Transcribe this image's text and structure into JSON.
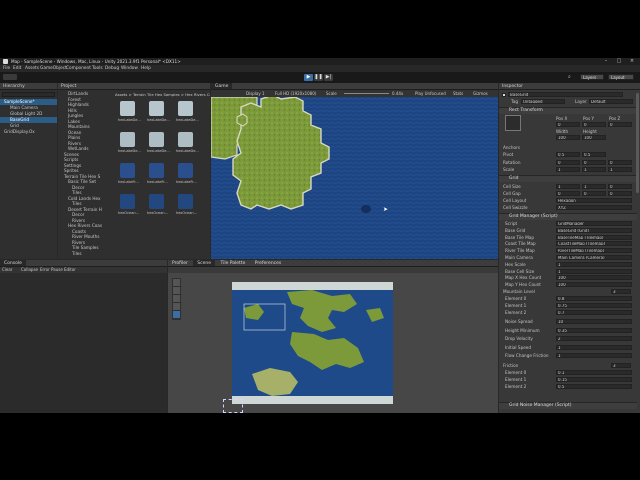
{
  "window": {
    "title": "Map - SampleScene - Windows, Mac, Linux - Unity 2021.3.9f1 Personal* <DX11>",
    "menu": [
      "File",
      "Edit",
      "Assets",
      "GameObject",
      "Component",
      "Tools",
      "Debug",
      "Window",
      "Help"
    ]
  },
  "toolbar": {
    "layers": "Layers",
    "layout": "Layout"
  },
  "hierarchy": {
    "tab": "Hierarchy",
    "items": [
      "SampleScene*",
      "Main Camera",
      "Global Light 2D",
      "BaseGrid",
      "Grid",
      "GridDisplay.Ox"
    ]
  },
  "project": {
    "tab": "Project",
    "tree": [
      "DirtLands",
      "Forest",
      "Highlands",
      "Hills",
      "Jungles",
      "Lakes",
      "Mountains",
      "Ocean",
      "Plains",
      "Rivers",
      "WetLands",
      "Scenes",
      "Scripts",
      "Settings",
      "Sprites",
      "Terrain Tile Hex S",
      "Basic Tile Set",
      "Decor",
      "Tiles",
      "Cold Lands Hex",
      "Tiles",
      "Desert Terrain H",
      "Decor",
      "Rivers",
      "Hex Rivers Coas",
      "Coasts",
      "River Mouths",
      "Rivers",
      "Tile Samples",
      "Tiles"
    ],
    "breadcrumb": "Assets > Terrain Tile Hex Samples > Hex Rivers Coasts > Tiles",
    "assets": [
      "hexLakeDe...",
      "hexLakeDe...",
      "hexLakeDe...",
      "hexLakeDe...",
      "hexLakeDe...",
      "hexLakeDe...",
      "hexLakeFr...",
      "hexLakeFr...",
      "hexLakeFr...",
      "hexOcean...",
      "hexOcean...",
      "hexOcean..."
    ]
  },
  "game": {
    "tab": "Game",
    "display": "Display 1",
    "resolution": "Full HD (1920x1080)",
    "scale_label": "Scale",
    "scale_value": "0.44x",
    "play_mode": "Play Unfocused",
    "stats": "Stats",
    "gizmos": "Gizmos"
  },
  "console": {
    "tab": "Console",
    "buttons": [
      "Clear",
      "Collapse",
      "Error Pause",
      "Editor"
    ]
  },
  "scene": {
    "tabs": [
      "Profiler",
      "Scene",
      "Tile Palette",
      "Preferences"
    ]
  },
  "inspector": {
    "tab": "Inspector",
    "object_name": "BaseGrid",
    "tag_label": "Tag",
    "tag_value": "Untagged",
    "layer_label": "Layer",
    "layer_value": "Default",
    "rect_transform": "Rect Transform",
    "pos_labels": [
      "Pos X",
      "Pos Y",
      "Pos Z"
    ],
    "pos_values": [
      "0",
      "0",
      "0"
    ],
    "size_labels": [
      "Width",
      "Height"
    ],
    "size_values": [
      "100",
      "100"
    ],
    "anchors": "Anchors",
    "pivot_label": "Pivot",
    "pivot_values": [
      "0.5",
      "0.5"
    ],
    "rotation_label": "Rotation",
    "rotation_values": [
      "0",
      "0",
      "0"
    ],
    "scale_label": "Scale",
    "scale_values": [
      "1",
      "1",
      "1"
    ],
    "grid_section": "Grid",
    "cell_size_label": "Cell Size",
    "cell_size": [
      "1",
      "1",
      "0"
    ],
    "cell_gap_label": "Cell Gap",
    "cell_gap": [
      "0",
      "0",
      "0"
    ],
    "cell_layout_label": "Cell Layout",
    "cell_layout": "Hexagon",
    "cell_swizzle_label": "Cell Swizzle",
    "cell_swizzle": "XYZ",
    "grid_manager": "Grid Manager (Script)",
    "props": [
      {
        "label": "Script",
        "value": "GridManager"
      },
      {
        "label": "Base Grid",
        "value": "BaseGrid (Grid)"
      },
      {
        "label": "Base Tile Map",
        "value": "BaseTileMap (Tilemap)"
      },
      {
        "label": "Coast Tile Map",
        "value": "CoastTileMap (Tilemap)"
      },
      {
        "label": "River Tile Map",
        "value": "RiverTileMap (Tilemap)"
      },
      {
        "label": "Main Camera",
        "value": "Main Camera (Camera)"
      },
      {
        "label": "Hex Scale",
        "value": "1"
      },
      {
        "label": "Base Cell Size",
        "value": "1"
      },
      {
        "label": "Map X Hex Count",
        "value": "100"
      },
      {
        "label": "Map Y Hex Count",
        "value": "100"
      }
    ],
    "mountain_level": "Mountain Level",
    "mountain_count": "3",
    "mountain_elements": [
      {
        "label": "Element 0",
        "value": "0.8"
      },
      {
        "label": "Element 1",
        "value": "0.75"
      },
      {
        "label": "Element 2",
        "value": "0.7"
      }
    ],
    "props2": [
      {
        "label": "Noise Spread",
        "value": "10"
      },
      {
        "label": "Height Minimum",
        "value": "0.35"
      },
      {
        "label": "Drop Velocity",
        "value": "2"
      },
      {
        "label": "Initial Speed",
        "value": "1"
      },
      {
        "label": "Flow Change Friction",
        "value": "1"
      }
    ],
    "friction": "Friction",
    "friction_count": "3",
    "friction_elements": [
      {
        "label": "Element 0",
        "value": "0.1"
      },
      {
        "label": "Element 1",
        "value": "0.15"
      },
      {
        "label": "Element 2",
        "value": "0.5"
      }
    ],
    "noise_manager": "Grid Noise Manager (Script)"
  },
  "colors": {
    "selection": "#2c5d87",
    "ocean": "#1c3f78",
    "land": "#7d9a3a",
    "ice": "#cfd6d6",
    "panel": "#383838"
  }
}
